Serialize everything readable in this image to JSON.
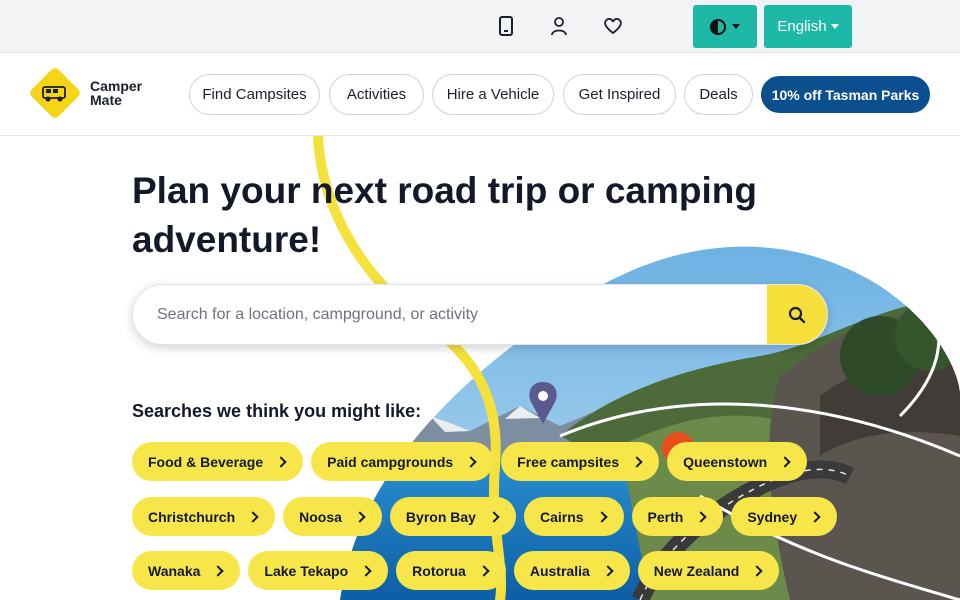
{
  "topbar": {
    "icons": [
      "phone-icon",
      "user-icon",
      "heart-icon"
    ],
    "language": "English"
  },
  "nav": {
    "logo_line1": "Camper",
    "logo_line2": "Mate",
    "items": [
      {
        "label": "Find Campsites"
      },
      {
        "label": "Activities"
      },
      {
        "label": "Hire a Vehicle"
      },
      {
        "label": "Get Inspired"
      },
      {
        "label": "Deals"
      }
    ],
    "cta": "10% off Tasman Parks"
  },
  "hero": {
    "headline_line1": "Plan your next road trip or camping",
    "headline_line2": "adventure!",
    "search_placeholder": "Search for a location, campground, or activity",
    "suggest_title": "Searches we think you might like:"
  },
  "chips": [
    [
      "Food & Beverage",
      "Paid campgrounds",
      "Free campsites",
      "Queenstown"
    ],
    [
      "Christchurch",
      "Noosa",
      "Byron Bay",
      "Cairns",
      "Perth",
      "Sydney"
    ],
    [
      "Wanaka",
      "Lake Tekapo",
      "Rotorua",
      "Australia",
      "New Zealand"
    ]
  ],
  "colors": {
    "accent_teal": "#1eb8a6",
    "cta_blue": "#0b4f8f",
    "chip_yellow": "#f6e64a",
    "brand_yellow": "#f6d417"
  }
}
